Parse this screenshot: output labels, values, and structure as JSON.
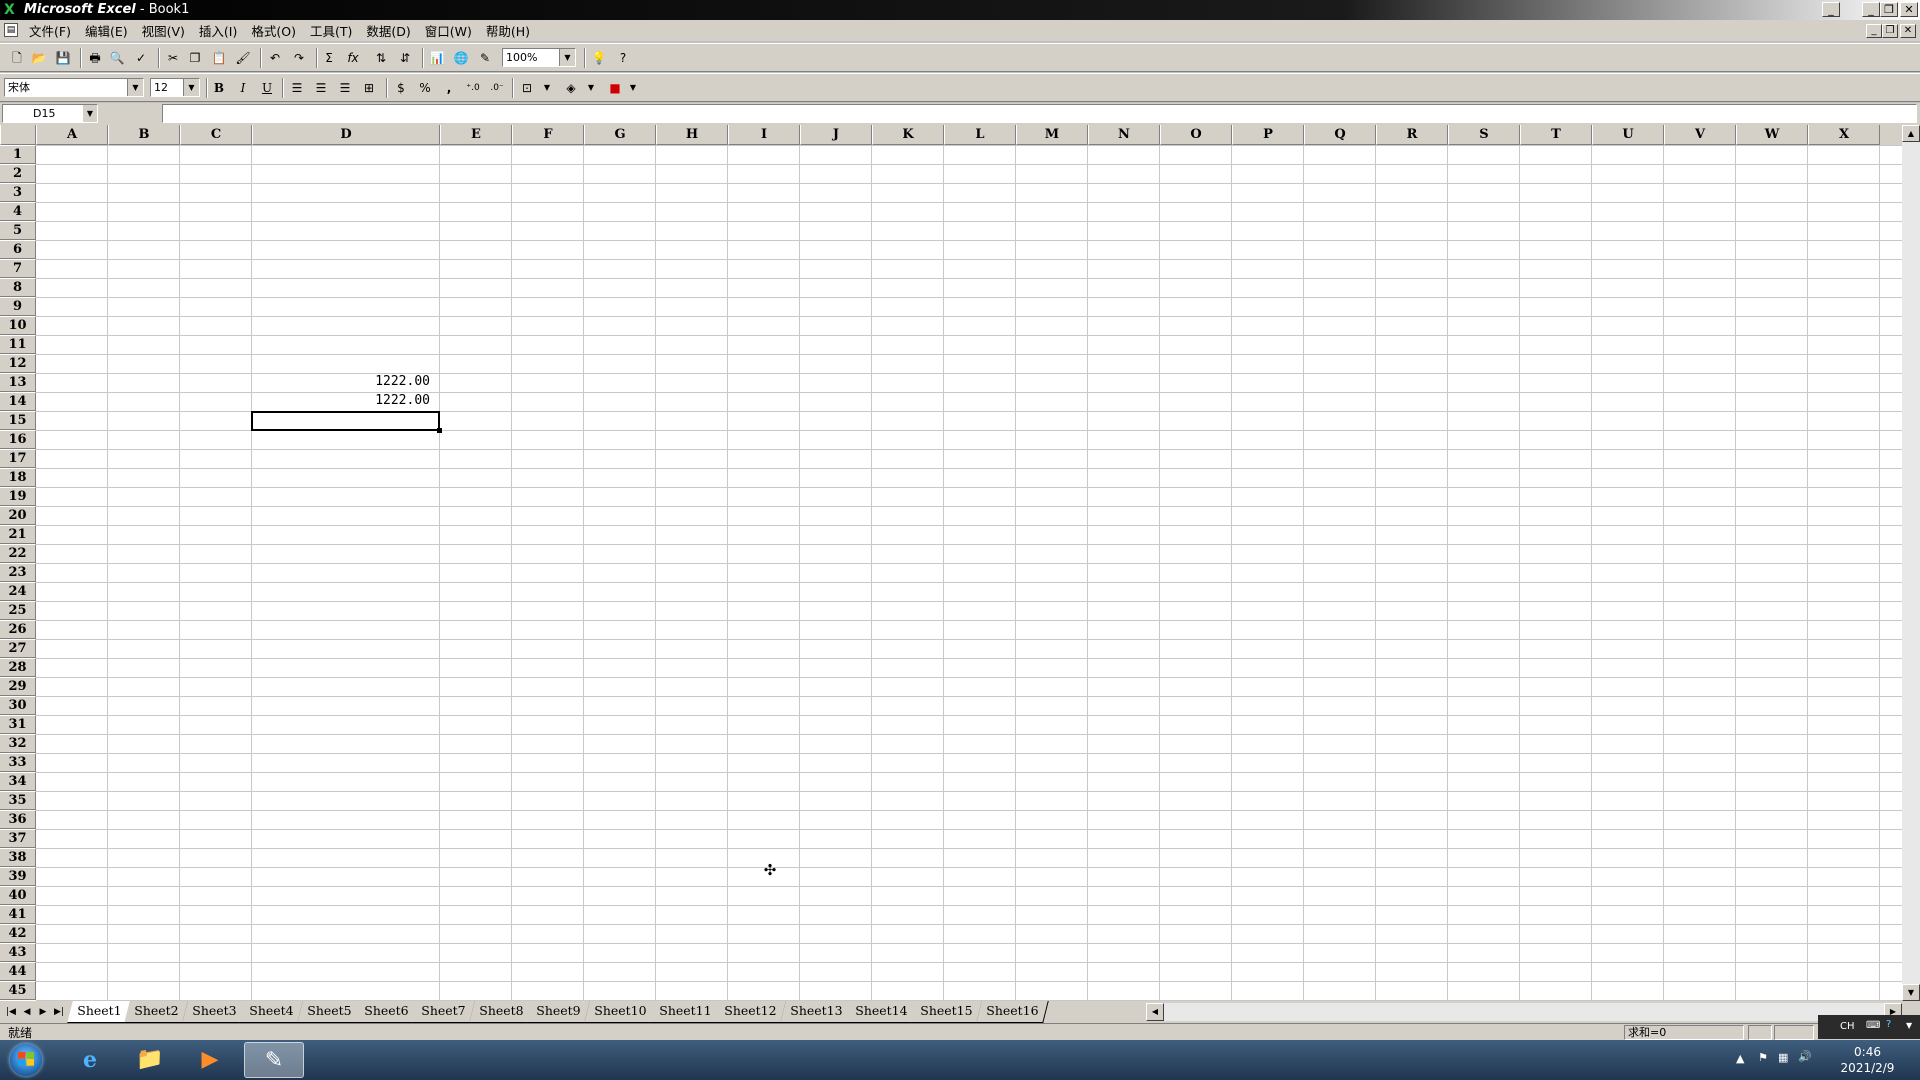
{
  "window": {
    "app_name": "Microsoft Excel",
    "doc_title": " - Book1",
    "min": "_",
    "restore": "❐",
    "close": "✕"
  },
  "menu": [
    "文件(F)",
    "编辑(E)",
    "视图(V)",
    "插入(I)",
    "格式(O)",
    "工具(T)",
    "数据(D)",
    "窗口(W)",
    "帮助(H)"
  ],
  "toolbar": {
    "zoom": "100%",
    "font_name": "宋体",
    "font_size": "12",
    "bold": "B",
    "italic": "I",
    "underline": "U",
    "autosum": "Σ",
    "function": "fx",
    "percent": "%",
    "comma": ","
  },
  "name_box": "D15",
  "columns": [
    "A",
    "B",
    "C",
    "D",
    "E",
    "F",
    "G",
    "H",
    "I",
    "J",
    "K",
    "L",
    "M",
    "N",
    "O",
    "P",
    "Q",
    "R",
    "S",
    "T",
    "U",
    "V",
    "W",
    "X"
  ],
  "rows": [
    "1",
    "2",
    "3",
    "4",
    "5",
    "6",
    "7",
    "8",
    "9",
    "10",
    "11",
    "12",
    "13",
    "14",
    "15",
    "16",
    "17",
    "18",
    "19",
    "20",
    "21",
    "22",
    "23",
    "24",
    "25",
    "26",
    "27",
    "28",
    "29",
    "30",
    "31",
    "32",
    "33",
    "34",
    "35",
    "36",
    "37",
    "38",
    "39",
    "40",
    "41",
    "42",
    "43",
    "44",
    "45"
  ],
  "cells": [
    {
      "ref": "D13",
      "value": "1222.00"
    },
    {
      "ref": "D14",
      "value": "1222.00"
    }
  ],
  "selected_cell": "D15",
  "sheets": [
    "Sheet1",
    "Sheet2",
    "Sheet3",
    "Sheet4",
    "Sheet5",
    "Sheet6",
    "Sheet7",
    "Sheet8",
    "Sheet9",
    "Sheet10",
    "Sheet11",
    "Sheet12",
    "Sheet13",
    "Sheet14",
    "Sheet15",
    "Sheet16"
  ],
  "active_sheet": "Sheet1",
  "status": {
    "ready": "就绪",
    "sum": "求和=0"
  },
  "language_bar": {
    "label": "CH"
  },
  "clock": {
    "time": "0:46",
    "date": "2021/2/9"
  },
  "colors": {
    "title_bg": "#000000",
    "chrome": "#d4d0c8",
    "taskbar": "#2b4a6b"
  }
}
